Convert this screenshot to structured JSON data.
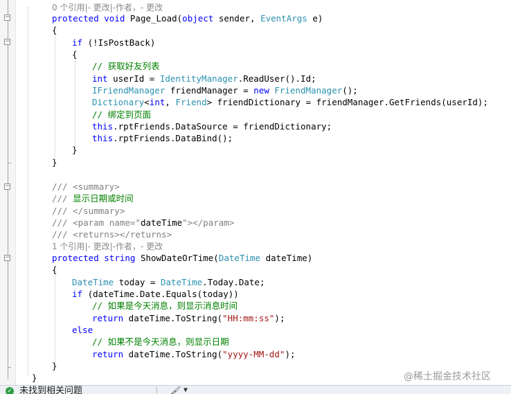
{
  "code": {
    "lens_page_load": "0 个引用|- 更改|-作者，- 更改",
    "page_load_modifier": "protected",
    "page_load_void": "void",
    "page_load_rest": " Page_Load(",
    "page_load_object": "object",
    "page_load_sender": " sender, ",
    "page_load_eventargs": "EventArgs",
    "page_load_e": " e)",
    "brace_open": "{",
    "brace_close": "}",
    "if_kw": "if",
    "if_rest": " (!IsPostBack)",
    "comment_get_friends": "// 获取好友列表",
    "int_kw": "int",
    "userid_rest": " userId = ",
    "identity_manager": "IdentityManager",
    "readuser_rest": ".ReadUser().Id;",
    "ifriend_manager": "IFriendManager",
    "friendmanager_rest": " friendManager = ",
    "new_kw": "new",
    "friend_manager_type": "FriendManager",
    "friend_manager_ctor_end": "();",
    "dictionary_type": "Dictionary",
    "dict_lt": "<",
    "dict_int": "int",
    "dict_comma": ", ",
    "friend_type": "Friend",
    "dict_rest": "> friendDictionary = friendManager.GetFriends(userId);",
    "comment_bind_page": "// 绑定到页面",
    "this_kw": "this",
    "datasource_rest": ".rptFriends.DataSource = friendDictionary;",
    "databind_rest": ".rptFriends.DataBind();",
    "doc_summary_open": "/// <summary>",
    "doc_prefix": "/// ",
    "doc_summary_text": "显示日期或时间",
    "doc_summary_close": "/// </summary>",
    "doc_param_a": "/// <param name=\"",
    "doc_param_name": "dateTime",
    "doc_param_b": "\"></param>",
    "doc_returns": "/// <returns></returns>",
    "lens_show_date": "1 个引用|- 更改|-作者，- 更改",
    "show_modifier": "protected",
    "show_string": "string",
    "show_rest": " ShowDateOrTime(",
    "datetime_type": "DateTime",
    "show_param": " dateTime)",
    "today_rest": " today = ",
    "today_value": ".Today.Date;",
    "if_equals_rest": " (dateTime.Date.Equals(today))",
    "comment_today": "// 如果是今天消息，则显示消息时间",
    "return_kw": "return",
    "tostring_open": " dateTime.ToString(",
    "time_format": "\"HH:mm:ss\"",
    "tostring_close": ");",
    "else_kw": "else",
    "comment_not_today": "// 如果不是今天消息，则显示日期",
    "date_format": "\"yyyy-MM-dd\""
  },
  "watermark": "@稀土掘金技术社区",
  "status": {
    "text": "未找到相关问题",
    "check_glyph": "✓",
    "brush_glyph": "🖌",
    "caret_glyph": "▼"
  }
}
